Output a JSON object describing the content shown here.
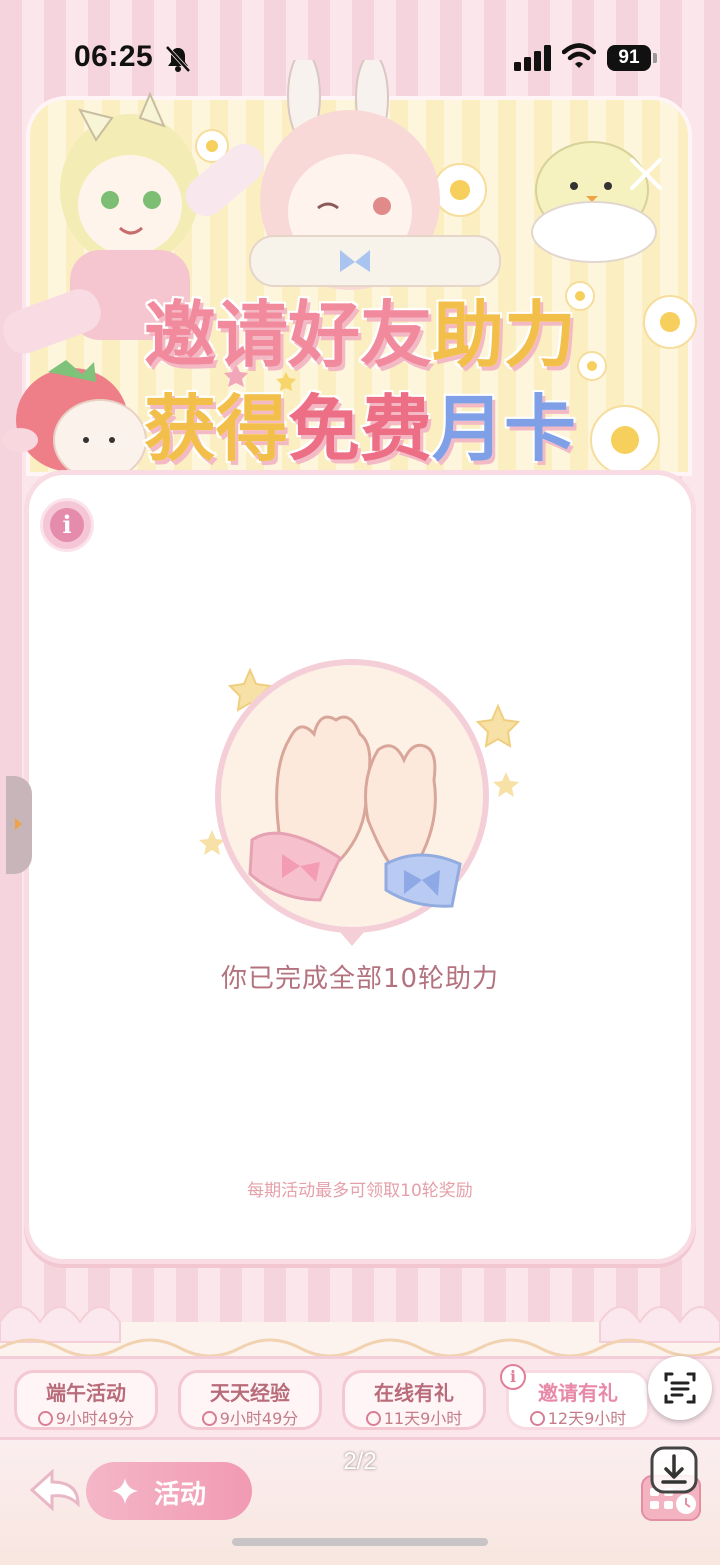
{
  "status_bar": {
    "time": "06:25",
    "battery": "91",
    "icons": [
      "bell-slash-icon",
      "signal-icon",
      "wifi-icon",
      "battery-icon"
    ]
  },
  "banner": {
    "title_line1": [
      {
        "text": "邀请好友",
        "color": "#f08a9c"
      },
      {
        "text": "助力",
        "color": "#f2c04a"
      }
    ],
    "title_line2": [
      {
        "text": "获得",
        "color": "#f2c04a"
      },
      {
        "text": "免费",
        "color": "#ec6f86"
      },
      {
        "text": "月卡",
        "color": "#7f9fe6"
      }
    ],
    "close_icon": "close-icon"
  },
  "card": {
    "info_icon": "info-icon",
    "info_symbol": "i",
    "completed_text": "你已完成全部10轮助力",
    "note_text": "每期活动最多可领取10轮奖励"
  },
  "tabs": [
    {
      "name": "端午活动",
      "timer": "9小时49分",
      "active": false
    },
    {
      "name": "天天经验",
      "timer": "9小时49分",
      "active": false
    },
    {
      "name": "在线有礼",
      "timer": "11天9小时",
      "active": false
    },
    {
      "name": "邀请有礼",
      "timer": "12天9小时",
      "active": true
    }
  ],
  "tab_info_symbol": "i",
  "bottom": {
    "activity_label": "活动",
    "page_indicator": "2/2"
  },
  "colors": {
    "accent_pink": "#f19ab3",
    "text_rose": "#b3727e",
    "note_pink": "#e6a0a9",
    "background": "#f7dfe6"
  }
}
